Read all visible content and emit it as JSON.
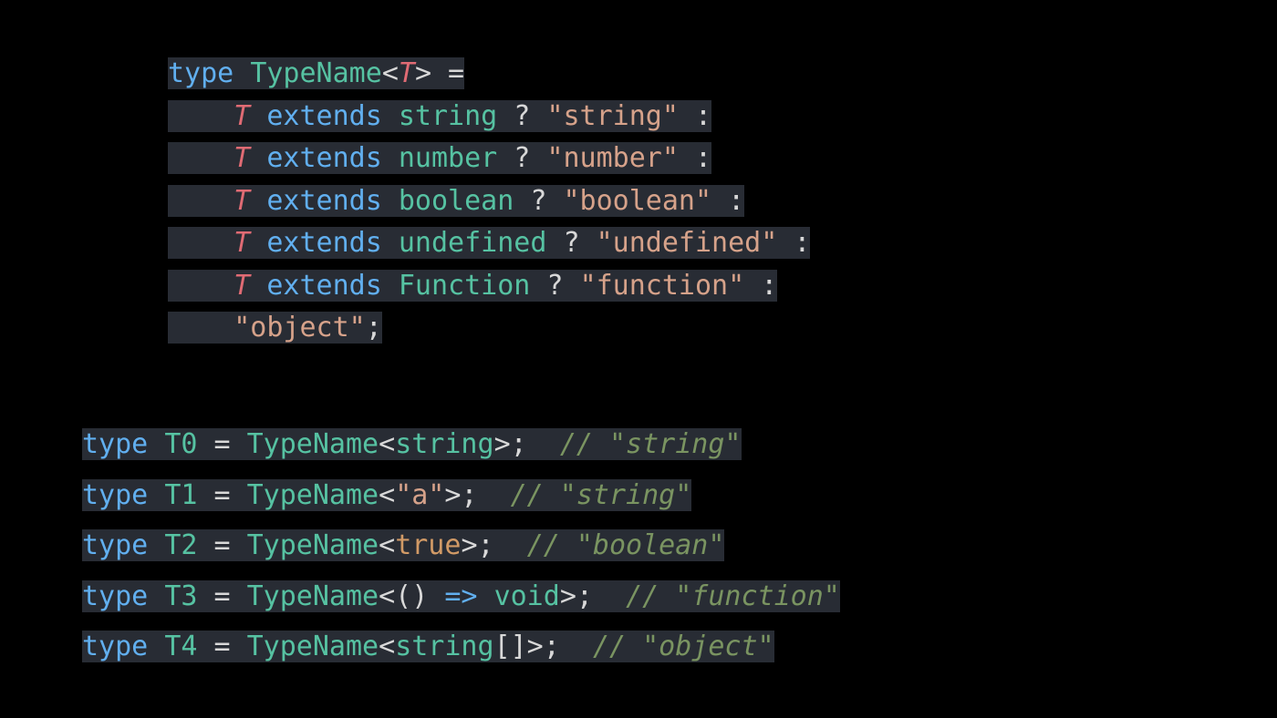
{
  "block1": {
    "lines": [
      {
        "tokens": [
          {
            "cls": "kw",
            "t": "type"
          },
          {
            "cls": "pun",
            "t": " "
          },
          {
            "cls": "typ2",
            "t": "TypeName"
          },
          {
            "cls": "pun",
            "t": "<"
          },
          {
            "cls": "tparam",
            "t": "T"
          },
          {
            "cls": "pun",
            "t": "> ="
          }
        ]
      },
      {
        "tokens": [
          {
            "cls": "pun",
            "t": "    "
          },
          {
            "cls": "tparam",
            "t": "T"
          },
          {
            "cls": "pun",
            "t": " "
          },
          {
            "cls": "kw",
            "t": "extends"
          },
          {
            "cls": "pun",
            "t": " "
          },
          {
            "cls": "typ",
            "t": "string"
          },
          {
            "cls": "pun",
            "t": " ? "
          },
          {
            "cls": "str",
            "t": "\"string\""
          },
          {
            "cls": "pun",
            "t": " :"
          }
        ]
      },
      {
        "tokens": [
          {
            "cls": "pun",
            "t": "    "
          },
          {
            "cls": "tparam",
            "t": "T"
          },
          {
            "cls": "pun",
            "t": " "
          },
          {
            "cls": "kw",
            "t": "extends"
          },
          {
            "cls": "pun",
            "t": " "
          },
          {
            "cls": "typ",
            "t": "number"
          },
          {
            "cls": "pun",
            "t": " ? "
          },
          {
            "cls": "str",
            "t": "\"number\""
          },
          {
            "cls": "pun",
            "t": " :"
          }
        ]
      },
      {
        "tokens": [
          {
            "cls": "pun",
            "t": "    "
          },
          {
            "cls": "tparam",
            "t": "T"
          },
          {
            "cls": "pun",
            "t": " "
          },
          {
            "cls": "kw",
            "t": "extends"
          },
          {
            "cls": "pun",
            "t": " "
          },
          {
            "cls": "typ",
            "t": "boolean"
          },
          {
            "cls": "pun",
            "t": " ? "
          },
          {
            "cls": "str",
            "t": "\"boolean\""
          },
          {
            "cls": "pun",
            "t": " :"
          }
        ]
      },
      {
        "tokens": [
          {
            "cls": "pun",
            "t": "    "
          },
          {
            "cls": "tparam",
            "t": "T"
          },
          {
            "cls": "pun",
            "t": " "
          },
          {
            "cls": "kw",
            "t": "extends"
          },
          {
            "cls": "pun",
            "t": " "
          },
          {
            "cls": "typ",
            "t": "undefined"
          },
          {
            "cls": "pun",
            "t": " ? "
          },
          {
            "cls": "str",
            "t": "\"undefined\""
          },
          {
            "cls": "pun",
            "t": " :"
          }
        ]
      },
      {
        "tokens": [
          {
            "cls": "pun",
            "t": "    "
          },
          {
            "cls": "tparam",
            "t": "T"
          },
          {
            "cls": "pun",
            "t": " "
          },
          {
            "cls": "kw",
            "t": "extends"
          },
          {
            "cls": "pun",
            "t": " "
          },
          {
            "cls": "typ",
            "t": "Function"
          },
          {
            "cls": "pun",
            "t": " ? "
          },
          {
            "cls": "str",
            "t": "\"function\""
          },
          {
            "cls": "pun",
            "t": " :"
          }
        ]
      },
      {
        "tokens": [
          {
            "cls": "pun",
            "t": "    "
          },
          {
            "cls": "str",
            "t": "\"object\""
          },
          {
            "cls": "pun",
            "t": ";"
          }
        ]
      }
    ]
  },
  "block2": {
    "lines": [
      {
        "tokens": [
          {
            "cls": "kw",
            "t": "type"
          },
          {
            "cls": "pun",
            "t": " "
          },
          {
            "cls": "typ2",
            "t": "T0"
          },
          {
            "cls": "pun",
            "t": " = "
          },
          {
            "cls": "typ2",
            "t": "TypeName"
          },
          {
            "cls": "pun",
            "t": "<"
          },
          {
            "cls": "typ",
            "t": "string"
          },
          {
            "cls": "pun",
            "t": ">;  "
          },
          {
            "cls": "cmt",
            "t": "// \"string\""
          }
        ]
      },
      {
        "tokens": [
          {
            "cls": "kw",
            "t": "type"
          },
          {
            "cls": "pun",
            "t": " "
          },
          {
            "cls": "typ2",
            "t": "T1"
          },
          {
            "cls": "pun",
            "t": " = "
          },
          {
            "cls": "typ2",
            "t": "TypeName"
          },
          {
            "cls": "pun",
            "t": "<"
          },
          {
            "cls": "str",
            "t": "\"a\""
          },
          {
            "cls": "pun",
            "t": ">;  "
          },
          {
            "cls": "cmt",
            "t": "// \"string\""
          }
        ]
      },
      {
        "tokens": [
          {
            "cls": "kw",
            "t": "type"
          },
          {
            "cls": "pun",
            "t": " "
          },
          {
            "cls": "typ2",
            "t": "T2"
          },
          {
            "cls": "pun",
            "t": " = "
          },
          {
            "cls": "typ2",
            "t": "TypeName"
          },
          {
            "cls": "pun",
            "t": "<"
          },
          {
            "cls": "lit",
            "t": "true"
          },
          {
            "cls": "pun",
            "t": ">;  "
          },
          {
            "cls": "cmt",
            "t": "// \"boolean\""
          }
        ]
      },
      {
        "tokens": [
          {
            "cls": "kw",
            "t": "type"
          },
          {
            "cls": "pun",
            "t": " "
          },
          {
            "cls": "typ2",
            "t": "T3"
          },
          {
            "cls": "pun",
            "t": " = "
          },
          {
            "cls": "typ2",
            "t": "TypeName"
          },
          {
            "cls": "pun",
            "t": "<() "
          },
          {
            "cls": "kw",
            "t": "=>"
          },
          {
            "cls": "pun",
            "t": " "
          },
          {
            "cls": "void",
            "t": "void"
          },
          {
            "cls": "pun",
            "t": ">;  "
          },
          {
            "cls": "cmt",
            "t": "// \"function\""
          }
        ]
      },
      {
        "tokens": [
          {
            "cls": "kw",
            "t": "type"
          },
          {
            "cls": "pun",
            "t": " "
          },
          {
            "cls": "typ2",
            "t": "T4"
          },
          {
            "cls": "pun",
            "t": " = "
          },
          {
            "cls": "typ2",
            "t": "TypeName"
          },
          {
            "cls": "pun",
            "t": "<"
          },
          {
            "cls": "typ",
            "t": "string"
          },
          {
            "cls": "pun",
            "t": "[]>;  "
          },
          {
            "cls": "cmt",
            "t": "// \"object\""
          }
        ]
      }
    ]
  }
}
